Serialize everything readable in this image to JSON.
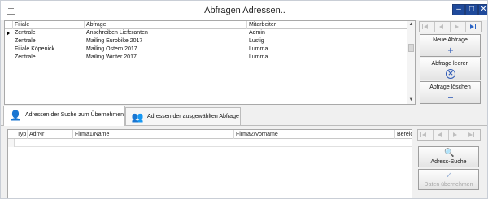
{
  "window": {
    "title": "Abfragen Adressen.."
  },
  "queries_table": {
    "headers": [
      "Filiale",
      "Abfrage",
      "Mitarbeiter"
    ],
    "rows": [
      {
        "filiale": "Zentrale",
        "abfrage": "Anschreiben Lieferanten",
        "mitarbeiter": "Admin",
        "current": true
      },
      {
        "filiale": "Zentrale",
        "abfrage": "Mailing Eurobike 2017",
        "mitarbeiter": "Lustig",
        "current": false
      },
      {
        "filiale": "Filiale Köpenick",
        "abfrage": "Mailing Ostern 2017",
        "mitarbeiter": "Lumma",
        "current": false
      },
      {
        "filiale": "Zentrale",
        "abfrage": "Mailing Winter 2017",
        "mitarbeiter": "Lumma",
        "current": false
      }
    ]
  },
  "query_actions": {
    "new_label": "Neue Abfrage",
    "new_icon": "plus-icon",
    "clear_label": "Abfrage leeren",
    "clear_icon": "circle-x-icon",
    "delete_label": "Abfrage löschen",
    "delete_icon": "minus-icon"
  },
  "tabs": [
    {
      "label": "Adressen der Suche zum Übernehmen",
      "icon": "add-contact-icon",
      "active": true
    },
    {
      "label": "Adressen der ausgewählten Abfrage",
      "icon": "contacts-icon",
      "active": false
    }
  ],
  "address_table": {
    "headers": [
      "Typ",
      "AdrNr",
      "Firma1/Name",
      "Firma2/Vorname",
      "Bereic"
    ]
  },
  "address_actions": {
    "search_label": "Adress-Suche",
    "search_icon": "search-icon",
    "accept_label": "Daten übernehmen",
    "accept_icon": "checkmark-icon",
    "accept_enabled": false
  },
  "colors": {
    "accent": "#2f5bb7",
    "title_button": "#1f4a9b"
  }
}
